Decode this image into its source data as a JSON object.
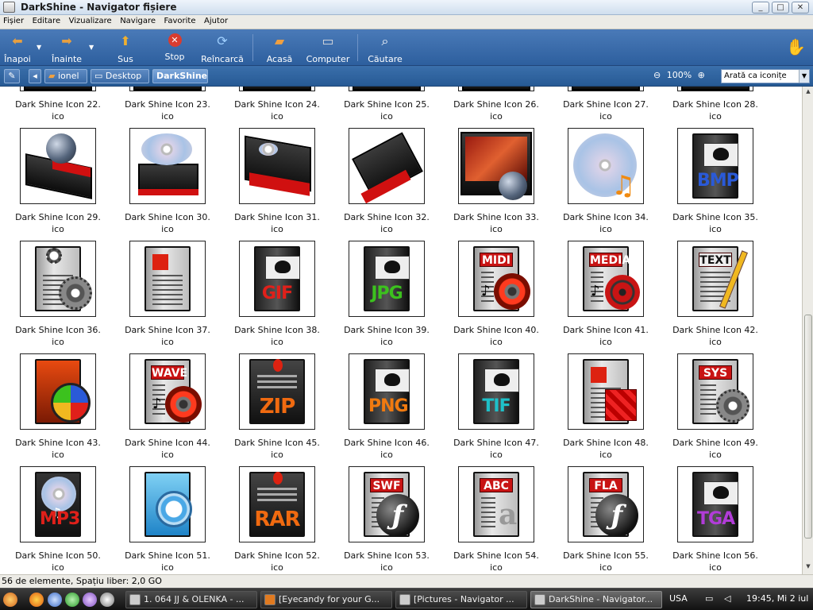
{
  "window": {
    "title": "DarkShine - Navigator fișiere",
    "controls": [
      "_",
      "□",
      "✕"
    ]
  },
  "menu": [
    "Fișier",
    "Editare",
    "Vizualizare",
    "Navigare",
    "Favorite",
    "Ajutor"
  ],
  "toolbar": {
    "back": "Înapoi",
    "forward": "Înainte",
    "up": "Sus",
    "stop": "Stop",
    "reload": "Reîncarcă",
    "home": "Acasă",
    "computer": "Computer",
    "search": "Căutare"
  },
  "location": {
    "crumbs": [
      "ionel",
      "Desktop",
      "DarkShine"
    ],
    "zoom": "100%",
    "view_mode": "Arată ca iconițe"
  },
  "files": [
    {
      "name": "Dark Shine Icon 22.\nico",
      "thumb": "partial"
    },
    {
      "name": "Dark Shine Icon 23.\nico",
      "thumb": "partial"
    },
    {
      "name": "Dark Shine Icon 24.\nico",
      "thumb": "partial"
    },
    {
      "name": "Dark Shine Icon 25.\nico",
      "thumb": "partial"
    },
    {
      "name": "Dark Shine Icon 26.\nico",
      "thumb": "partial"
    },
    {
      "name": "Dark Shine Icon 27.\nico",
      "thumb": "partial"
    },
    {
      "name": "Dark Shine Icon 28.\nico",
      "thumb": "partial"
    },
    {
      "name": "Dark Shine Icon 29.\nico",
      "thumb": "globe-device"
    },
    {
      "name": "Dark Shine Icon 30.\nico",
      "thumb": "disc-drive"
    },
    {
      "name": "Dark Shine Icon 31.\nico",
      "thumb": "dvd-drive"
    },
    {
      "name": "Dark Shine Icon 32.\nico",
      "thumb": "memory-card"
    },
    {
      "name": "Dark Shine Icon 33.\nico",
      "thumb": "monitor-globe"
    },
    {
      "name": "Dark Shine Icon 34.\nico",
      "thumb": "music-disc"
    },
    {
      "name": "Dark Shine Icon 35.\nico",
      "thumb": "image-file",
      "label": "BMP",
      "color": "#2a5ad8"
    },
    {
      "name": "Dark Shine Icon 36.\nico",
      "thumb": "settings-file"
    },
    {
      "name": "Dark Shine Icon 37.\nico",
      "thumb": "document-file"
    },
    {
      "name": "Dark Shine Icon 38.\nico",
      "thumb": "image-file",
      "label": "GIF",
      "color": "#e0201a"
    },
    {
      "name": "Dark Shine Icon 39.\nico",
      "thumb": "image-file",
      "label": "JPG",
      "color": "#3cc21e"
    },
    {
      "name": "Dark Shine Icon 40.\nico",
      "thumb": "audio-file",
      "label": "MIDI"
    },
    {
      "name": "Dark Shine Icon 41.\nico",
      "thumb": "media-file",
      "label": "MEDIA"
    },
    {
      "name": "Dark Shine Icon 42.\nico",
      "thumb": "text-file",
      "label": "TEXT"
    },
    {
      "name": "Dark Shine Icon 43.\nico",
      "thumb": "video-file"
    },
    {
      "name": "Dark Shine Icon 44.\nico",
      "thumb": "audio-file",
      "label": "WAVE"
    },
    {
      "name": "Dark Shine Icon 45.\nico",
      "thumb": "archive-file",
      "label": "ZIP",
      "color": "#f06a10"
    },
    {
      "name": "Dark Shine Icon 46.\nico",
      "thumb": "image-file",
      "label": "PNG",
      "color": "#f07a10"
    },
    {
      "name": "Dark Shine Icon 47.\nico",
      "thumb": "image-file",
      "label": "TIF",
      "color": "#1ec0c8"
    },
    {
      "name": "Dark Shine Icon 48.\nico",
      "thumb": "package-file"
    },
    {
      "name": "Dark Shine Icon 49.\nico",
      "thumb": "system-file",
      "label": "SYS"
    },
    {
      "name": "Dark Shine Icon 50.\nico",
      "thumb": "mp3-file",
      "label": "MP3",
      "color": "#e0201a"
    },
    {
      "name": "Dark Shine Icon 51.\nico",
      "thumb": "quicktime-file"
    },
    {
      "name": "Dark Shine Icon 52.\nico",
      "thumb": "archive-file",
      "label": "RAR",
      "color": "#f06a10"
    },
    {
      "name": "Dark Shine Icon 53.\nico",
      "thumb": "flash-file",
      "label": "SWF"
    },
    {
      "name": "Dark Shine Icon 54.\nico",
      "thumb": "font-file",
      "label": "ABC"
    },
    {
      "name": "Dark Shine Icon 55.\nico",
      "thumb": "flash-file",
      "label": "FLA"
    },
    {
      "name": "Dark Shine Icon 56.\nico",
      "thumb": "image-file",
      "label": "TGA",
      "color": "#b13cd8"
    }
  ],
  "status": "56 de elemente, Spațiu liber: 2,0 GO",
  "taskbar": {
    "tasks": [
      {
        "label": "1. 064 JJ & OLENKA - ...",
        "active": false
      },
      {
        "label": "[Eyecandy for your G...",
        "active": false
      },
      {
        "label": "[Pictures - Navigator ...",
        "active": false
      },
      {
        "label": "DarkShine - Navigator...",
        "active": true
      }
    ],
    "keyboard": "USA",
    "clock": "19:45, Mi  2 iul"
  }
}
